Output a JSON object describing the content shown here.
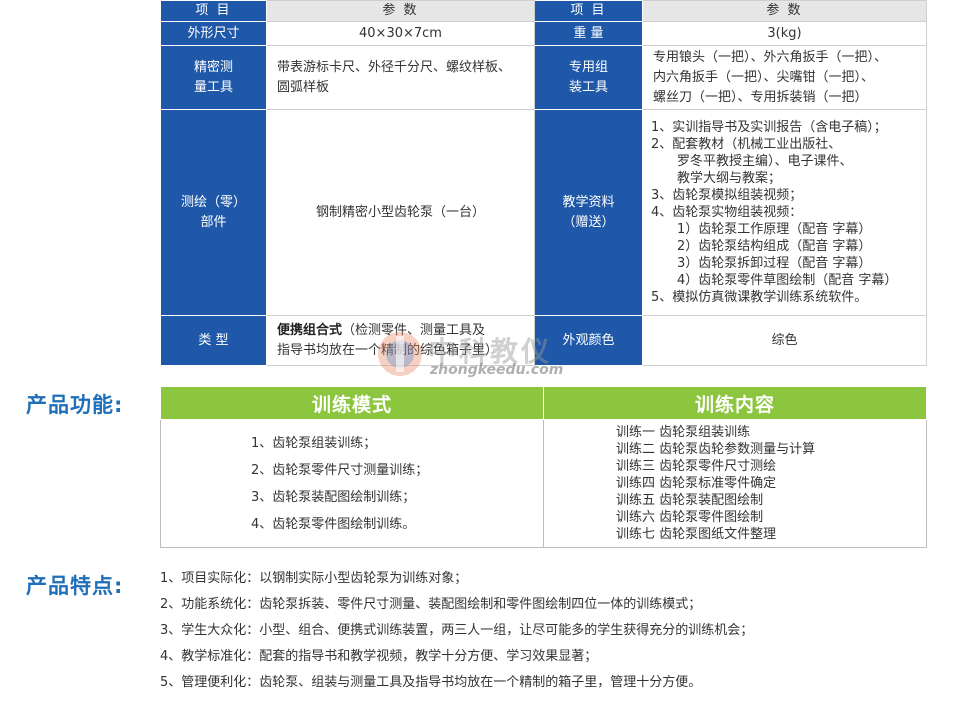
{
  "spec_table": {
    "header": {
      "item_label": "项 目",
      "param_label": "参 数",
      "item_label2": "项 目",
      "param_label2": "参 数"
    },
    "size": {
      "label": "外形尺寸",
      "value": "40×30×7cm"
    },
    "weight": {
      "label": "重 量",
      "value": "3(kg)"
    },
    "precision_tools": {
      "label_lines": [
        "精密测",
        "量工具"
      ],
      "value_lines": [
        "带表游标卡尺、外径千分尺、螺纹样板、",
        "圆弧样板"
      ]
    },
    "assembly_tools": {
      "label_lines": [
        "专用组",
        "装工具"
      ],
      "value_lines": [
        "专用锒头（一把）、外六角扳手（一把）、",
        "内六角扳手（一把）、尖嘴钳（一把）、",
        "螺丝刀（一把）、专用拆装销（一把）"
      ]
    },
    "parts": {
      "label_lines": [
        "测绘（零）",
        "部件"
      ],
      "value": "钢制精密小型齿轮泵（一台）"
    },
    "materials": {
      "label_lines": [
        "教学资料",
        "（赠送）"
      ],
      "items": [
        "1、实训指导书及实训报告（含电子稿）；",
        "2、配套教材（机械工业出版社、",
        "　　罗冬平教授主编）、电子课件、",
        "　　教学大纲与教案；",
        "3、齿轮泵模拟组装视频；",
        "4、齿轮泵实物组装视频：",
        "　　1）齿轮泵工作原理（配音 字幕）",
        "　　2）齿轮泵结构组成（配音 字幕）",
        "　　3）齿轮泵拆卸过程（配音 字幕）",
        "　　4）齿轮泵零件草图绘制（配音 字幕）",
        "5、模拟仿真微课教学训练系统软件。"
      ]
    },
    "type": {
      "label": "类 型",
      "value_bold": "便携组合式",
      "value_rest": "（检测零件、测量工具及",
      "value_line2": "指导书均放在一个精制的综色箱子里）"
    },
    "color": {
      "label": "外观颜色",
      "value": "综色"
    }
  },
  "watermark": {
    "cn": "中科教仪",
    "en": "zhongkeedu.com"
  },
  "functions": {
    "title": "产品功能:",
    "mode_header": "训练模式",
    "content_header": "训练内容",
    "modes": [
      "1、齿轮泵组装训练；",
      "2、齿轮泵零件尺寸测量训练；",
      "3、齿轮泵装配图绘制训练；",
      "4、齿轮泵零件图绘制训练。"
    ],
    "contents": [
      "训练一  齿轮泵组装训练",
      "训练二  齿轮泵齿轮参数测量与计算",
      "训练三  齿轮泵零件尺寸测绘",
      "训练四  齿轮泵标准零件确定",
      "训练五  齿轮泵装配图绘制",
      "训练六  齿轮泵零件图绘制",
      "训练七  齿轮泵图纸文件整理"
    ]
  },
  "features": {
    "title": "产品特点:",
    "items": [
      "1、项目实际化：以钢制实际小型齿轮泵为训练对象；",
      "2、功能系统化：齿轮泵拆装、零件尺寸测量、装配图绘制和零件图绘制四位一体的训练模式；",
      "3、学生大众化：小型、组合、便携式训练装置，两三人一组，让尽可能多的学生获得充分的训练机会；",
      "4、教学标准化：配套的指导书和教学视频，教学十分方便、学习效果显著；",
      "5、管理便利化：齿轮泵、组装与测量工具及指导书均放在一个精制的箱子里，管理十分方便。"
    ]
  },
  "colors": {
    "header_blue": "#1f58a8",
    "title_blue": "#1f6fb8",
    "header_green": "#8cc63f"
  }
}
